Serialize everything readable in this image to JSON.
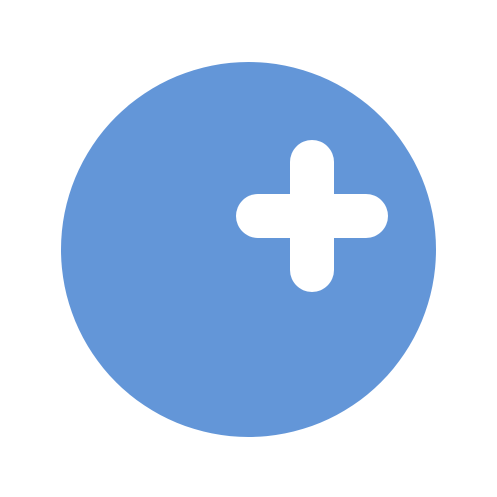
{
  "icon": {
    "name": "add-circle-icon",
    "colors": {
      "circle": "#6396d8",
      "plus": "#ffffff",
      "background": "#ffffff"
    }
  }
}
